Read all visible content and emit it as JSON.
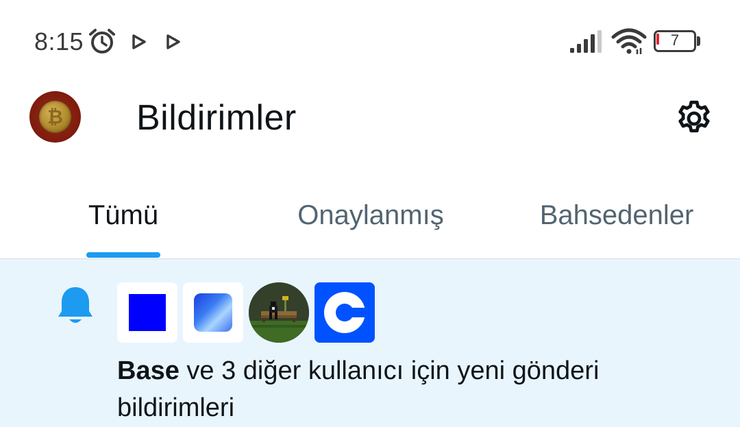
{
  "status_bar": {
    "time": "8:15",
    "battery_level": "7",
    "icons": [
      "alarm-icon",
      "play-icon",
      "play-icon",
      "signal-icon",
      "wifi-icon",
      "battery-icon"
    ]
  },
  "header": {
    "title": "Bildirimler",
    "avatar_icon": "bitcoin-coin-avatar",
    "settings_icon": "gear-icon"
  },
  "tabs": [
    {
      "label": "Tümü",
      "active": true
    },
    {
      "label": "Onaylanmış",
      "active": false
    },
    {
      "label": "Bahsedenler",
      "active": false
    }
  ],
  "notification": {
    "icon": "bell-icon",
    "avatars": [
      "base-avatar",
      "blue-gradient-avatar",
      "pixel-art-avatar",
      "coinbase-avatar"
    ],
    "bold_name": "Base",
    "text": " ve 3 diğer kullanıcı için yeni gönderi bildirimleri"
  },
  "colors": {
    "accent": "#1d9bf0",
    "notification_bg": "#e8f5fd",
    "text_primary": "#0f1419",
    "text_secondary": "#536471"
  }
}
